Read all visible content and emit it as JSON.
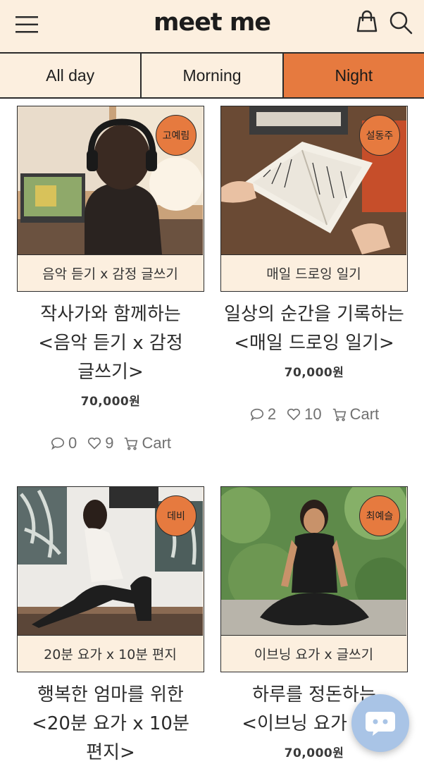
{
  "header": {
    "brand": "meet me",
    "icons": {
      "menu": "hamburger-menu-icon",
      "bag": "shopping-bag-icon",
      "search": "search-icon"
    }
  },
  "tabs": [
    {
      "label": "All day",
      "active": false
    },
    {
      "label": "Morning",
      "active": false
    },
    {
      "label": "Night",
      "active": true
    }
  ],
  "colors": {
    "accent": "#e67a3f",
    "background": "#fcefdf",
    "chat": "#a9c4e6"
  },
  "products": [
    {
      "badge": "고예림",
      "caption": "음악 듣기 x 감정 글쓰기",
      "title_lines": [
        "작사가와 함께하는",
        "<음악 듣기 x 감정",
        "글쓰기>"
      ],
      "price": "70,000원",
      "comments": "0",
      "likes": "9",
      "cart": "Cart"
    },
    {
      "badge": "설동주",
      "caption": "매일 드로잉 일기",
      "title_lines": [
        "일상의 순간을 기록하는",
        "<매일 드로잉 일기>"
      ],
      "price": "70,000원",
      "comments": "2",
      "likes": "10",
      "cart": "Cart"
    },
    {
      "badge": "데비",
      "caption": "20분 요가 x 10분 편지",
      "title_lines": [
        "행복한 엄마를 위한",
        "<20분 요가 x 10분",
        "편지>"
      ]
    },
    {
      "badge": "최예슬",
      "caption": "이브닝 요가 x 글쓰기",
      "title_lines": [
        "하루를 정돈하는",
        "<이브닝 요가 x 글"
      ],
      "price": "70,000원"
    }
  ],
  "chat": {
    "icon": "chat-bubble-icon"
  }
}
